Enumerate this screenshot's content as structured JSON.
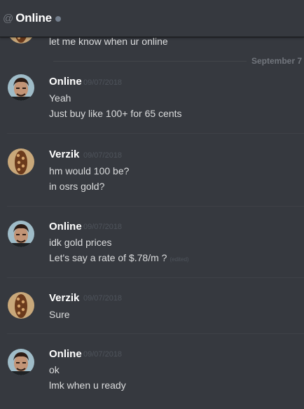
{
  "header": {
    "at_symbol": "@",
    "title": "Online"
  },
  "top_message": {
    "text": "let me know when ur online"
  },
  "date_divider": {
    "label": "September 7"
  },
  "groups": [
    {
      "author": "Online",
      "timestamp": "09/07/2018",
      "lines": [
        "Yeah",
        "Just buy like 100+ for 65 cents"
      ]
    },
    {
      "author": "Verzik",
      "timestamp": "09/07/2018",
      "lines": [
        "hm would 100 be?",
        "in osrs gold?"
      ]
    },
    {
      "author": "Online",
      "timestamp": "09/07/2018",
      "lines": [
        "idk gold prices",
        "Let's say a rate of $.78/m ?"
      ],
      "edited_label": "(edited)"
    },
    {
      "author": "Verzik",
      "timestamp": "09/07/2018",
      "lines": [
        "Sure"
      ]
    },
    {
      "author": "Online",
      "timestamp": "09/07/2018",
      "lines": [
        "ok",
        "lmk when u  ready"
      ]
    }
  ],
  "icons": {
    "status": "offline-status-dot",
    "online_avatar": "user-avatar-online",
    "verzik_avatar": "user-avatar-verzik"
  },
  "colors": {
    "background": "#36393f",
    "author": "#ffffff",
    "message_text": "#dcddde",
    "timestamp": "#4f545c",
    "status_offline": "#747f8d"
  }
}
